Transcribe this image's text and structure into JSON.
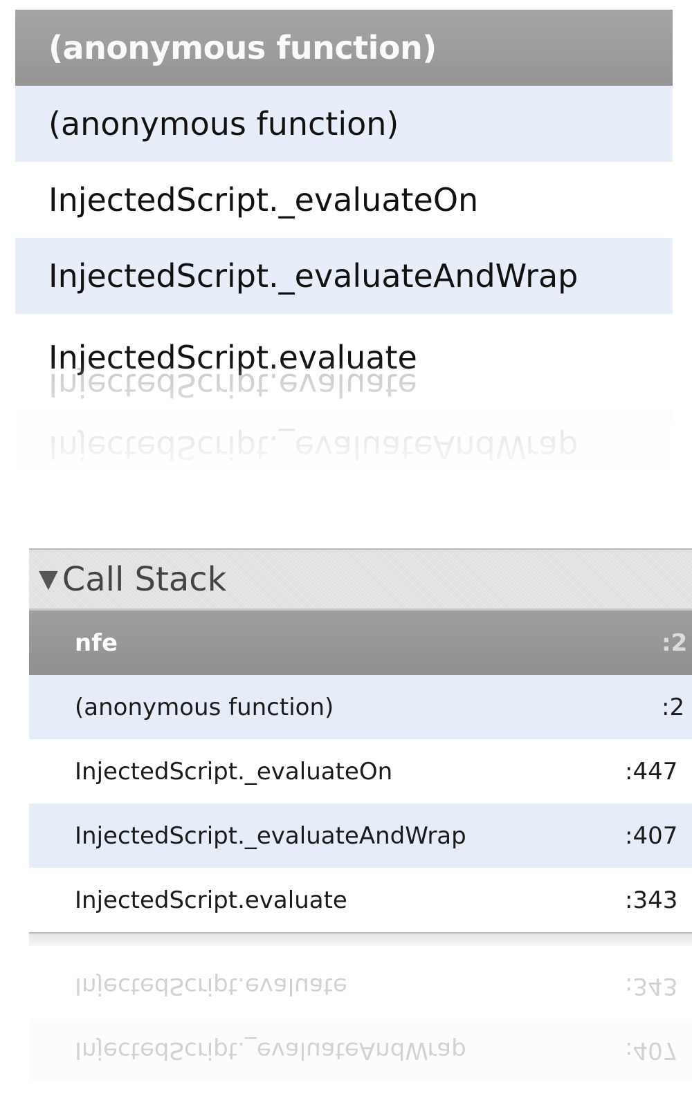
{
  "zoom_panel": {
    "rows": [
      {
        "label": "(anonymous function)",
        "state": "selected"
      },
      {
        "label": "(anonymous function)",
        "state": "alt"
      },
      {
        "label": "InjectedScript._evaluateOn",
        "state": "normal"
      },
      {
        "label": "InjectedScript._evaluateAndWrap",
        "state": "alt"
      },
      {
        "label": "InjectedScript.evaluate",
        "state": "normal"
      }
    ]
  },
  "call_stack": {
    "title": "Call Stack",
    "toggle_icon": "triangle-down-icon",
    "frames": [
      {
        "name": "nfe",
        "line": ":2"
      },
      {
        "name": "(anonymous function)",
        "line": ":2"
      },
      {
        "name": "InjectedScript._evaluateOn",
        "line": ":447"
      },
      {
        "name": "InjectedScript._evaluateAndWrap",
        "line": ":407"
      },
      {
        "name": "InjectedScript.evaluate",
        "line": ":343"
      }
    ]
  }
}
